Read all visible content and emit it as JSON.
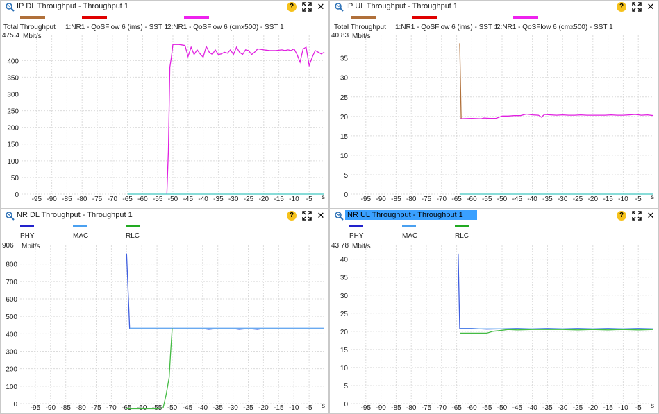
{
  "panels": [
    {
      "title": "IP DL Throughput - Throughput 1",
      "active": false,
      "legend": [
        {
          "name": "Total Throughput",
          "color": "#b0703a"
        },
        {
          "name": "1:NR1 - QoSFlow 6 (ims) - SST 1",
          "color": "#e00000"
        },
        {
          "name": "2:NR1 - QoSFlow 6 (cmx500) - SST 1",
          "color": "#ee22ee"
        }
      ],
      "chart_data": {
        "type": "line",
        "ymax_label": "475.4",
        "yunit": "Mbit/s",
        "xunit": "s",
        "xlim": [
          -100,
          0
        ],
        "ylim": [
          0,
          475.4
        ],
        "yticks": [
          0,
          50,
          100,
          150,
          200,
          250,
          300,
          350,
          400
        ],
        "xticks": [
          -95,
          -90,
          -85,
          -80,
          -75,
          -70,
          -65,
          -60,
          -55,
          -50,
          -45,
          -40,
          -35,
          -30,
          -25,
          -20,
          -15,
          -10,
          -5
        ],
        "series": [
          {
            "name": "2:NR1 - QoSFlow 6 (cmx500) - SST 1",
            "color": "#e020e0",
            "x": [
              -52,
              -51.5,
              -51,
              -50.5,
              -50,
              -48,
              -46,
              -45,
              -44,
              -43,
              -42,
              -41,
              -40,
              -39,
              -38,
              -37,
              -36,
              -35,
              -34,
              -33,
              -32,
              -31,
              -30,
              -29,
              -28,
              -27,
              -26,
              -25,
              -24,
              -23,
              -22,
              -20,
              -18,
              -16,
              -14,
              -13,
              -12,
              -11,
              -10,
              -9,
              -8,
              -7,
              -6,
              -5,
              -4,
              -3,
              -2,
              -1,
              0
            ],
            "y": [
              0,
              130,
              380,
              410,
              448,
              448,
              445,
              412,
              440,
              418,
              432,
              420,
              410,
              442,
              425,
              418,
              432,
              418,
              420,
              425,
              422,
              432,
              418,
              440,
              425,
              418,
              432,
              430,
              418,
              425,
              435,
              432,
              430,
              430,
              432,
              430,
              432,
              430,
              435,
              418,
              395,
              435,
              440,
              385,
              410,
              430,
              425,
              420,
              425
            ]
          },
          {
            "name": "Total Throughput",
            "color": "#40c8c0",
            "x": [
              -65,
              0
            ],
            "y": [
              0,
              0
            ]
          }
        ]
      }
    },
    {
      "title": "IP UL Throughput - Throughput 1",
      "active": false,
      "legend": [
        {
          "name": "Total Throughput",
          "color": "#b0703a"
        },
        {
          "name": "1:NR1 - QoSFlow 6 (ims) - SST 1",
          "color": "#e00000"
        },
        {
          "name": "2:NR1 - QoSFlow 6 (cmx500) - SST 1",
          "color": "#ee22ee"
        }
      ],
      "chart_data": {
        "type": "line",
        "ymax_label": "40.83",
        "yunit": "Mbit/s",
        "xunit": "s",
        "xlim": [
          -100,
          0
        ],
        "ylim": [
          0,
          40.83
        ],
        "yticks": [
          0,
          5,
          10,
          15,
          20,
          25,
          30,
          35
        ],
        "xticks": [
          -95,
          -90,
          -85,
          -80,
          -75,
          -70,
          -65,
          -60,
          -55,
          -50,
          -45,
          -40,
          -35,
          -30,
          -25,
          -20,
          -15,
          -10,
          -5
        ],
        "series": [
          {
            "name": "Total Throughput",
            "color": "#b0703a",
            "x": [
              -64,
              -63.5
            ],
            "y": [
              38.8,
              19.5
            ]
          },
          {
            "name": "2:NR1 - QoSFlow 6 (cmx500) - SST 1",
            "color": "#e020e0",
            "x": [
              -64,
              -60,
              -57,
              -56,
              -54,
              -52,
              -50,
              -48,
              -46,
              -44,
              -42,
              -40,
              -38,
              -37,
              -36,
              -34,
              -32,
              -30,
              -28,
              -26,
              -24,
              -22,
              -20,
              -18,
              -16,
              -14,
              -12,
              -10,
              -8,
              -6,
              -4,
              -2,
              0
            ],
            "y": [
              19.4,
              19.5,
              19.4,
              19.6,
              19.5,
              19.5,
              20.1,
              20.1,
              20.2,
              20.2,
              20.6,
              20.4,
              20.3,
              19.8,
              20.5,
              20.4,
              20.3,
              20.4,
              20.3,
              20.3,
              20.4,
              20.3,
              20.3,
              20.3,
              20.3,
              20.4,
              20.3,
              20.3,
              20.4,
              20.5,
              20.3,
              20.4,
              20.2
            ]
          },
          {
            "name": "1:NR1 - QoSFlow 6 (ims) - SST 1",
            "color": "#40c8c0",
            "x": [
              -64,
              0
            ],
            "y": [
              0,
              0
            ]
          }
        ]
      }
    },
    {
      "title": "NR DL Throughput - Throughput 1",
      "active": false,
      "legend": [
        {
          "name": "PHY",
          "color": "#2222cc"
        },
        {
          "name": "MAC",
          "color": "#4aa0f0"
        },
        {
          "name": "RLC",
          "color": "#22aa22"
        }
      ],
      "chart_data": {
        "type": "line",
        "ymax_label": "906",
        "yunit": "Mbit/s",
        "xunit": "s",
        "xlim": [
          -100,
          0
        ],
        "ylim": [
          0,
          906
        ],
        "yticks": [
          0,
          100,
          200,
          300,
          400,
          500,
          600,
          700,
          800
        ],
        "xticks": [
          -95,
          -90,
          -85,
          -80,
          -75,
          -70,
          -65,
          -60,
          -55,
          -50,
          -45,
          -40,
          -35,
          -30,
          -25,
          -20,
          -15,
          -10,
          -5
        ],
        "series": [
          {
            "name": "PHY",
            "color": "#3f5fe0",
            "x": [
              -65,
              -64,
              -60,
              -50,
              -45,
              -40,
              -38,
              -35,
              -30,
              -28,
              -25,
              -22,
              -20,
              -15,
              -10,
              -5,
              0
            ],
            "y": [
              860,
              430,
              430,
              430,
              430,
              430,
              425,
              430,
              430,
              425,
              430,
              425,
              430,
              430,
              430,
              430,
              430
            ]
          },
          {
            "name": "MAC",
            "color": "#6aaaf0",
            "x": [
              -64,
              0
            ],
            "y": [
              432,
              432
            ]
          },
          {
            "name": "RLC",
            "color": "#44bb44",
            "x": [
              -65,
              -55,
              -53,
              -52,
              -51,
              -50.5,
              -50
            ],
            "y": [
              -30,
              -30,
              -25,
              50,
              150,
              300,
              432
            ]
          }
        ]
      }
    },
    {
      "title": "NR UL Throughput - Throughput 1",
      "active": true,
      "legend": [
        {
          "name": "PHY",
          "color": "#2222cc"
        },
        {
          "name": "MAC",
          "color": "#4aa0f0"
        },
        {
          "name": "RLC",
          "color": "#22aa22"
        }
      ],
      "chart_data": {
        "type": "line",
        "ymax_label": "43.78",
        "yunit": "Mbit/s",
        "xunit": "s",
        "xlim": [
          -100,
          0
        ],
        "ylim": [
          0,
          43.78
        ],
        "yticks": [
          0,
          5,
          10,
          15,
          20,
          25,
          30,
          35,
          40
        ],
        "xticks": [
          -95,
          -90,
          -85,
          -80,
          -75,
          -70,
          -65,
          -60,
          -55,
          -50,
          -45,
          -40,
          -35,
          -30,
          -25,
          -20,
          -15,
          -10,
          -5
        ],
        "series": [
          {
            "name": "PHY",
            "color": "#3f5fe0",
            "x": [
              -64.5,
              -64,
              -60,
              -55,
              -50,
              -45,
              -40,
              -35,
              -30,
              -25,
              -20,
              -15,
              -10,
              -5,
              0
            ],
            "y": [
              41.5,
              20.8,
              20.8,
              20.6,
              20.7,
              20.8,
              20.7,
              20.8,
              20.7,
              20.8,
              20.7,
              20.8,
              20.7,
              20.8,
              20.7
            ]
          },
          {
            "name": "MAC",
            "color": "#6aaaf0",
            "x": [
              -64,
              0
            ],
            "y": [
              20.7,
              20.7
            ]
          },
          {
            "name": "RLC",
            "color": "#44bb44",
            "x": [
              -64,
              -55,
              -53,
              -50,
              -48,
              -45,
              -40,
              -35,
              -30,
              -25,
              -20,
              -15,
              -10,
              -5,
              0
            ],
            "y": [
              19.5,
              19.5,
              20.0,
              20.3,
              20.5,
              20.4,
              20.5,
              20.5,
              20.5,
              20.4,
              20.5,
              20.4,
              20.5,
              20.4,
              20.5
            ]
          }
        ]
      }
    }
  ]
}
